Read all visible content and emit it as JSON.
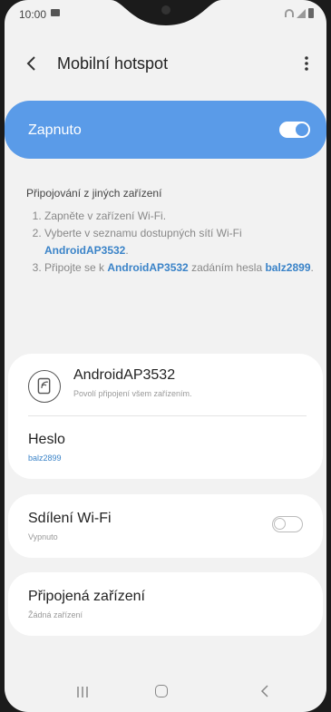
{
  "status": {
    "time": "10:00"
  },
  "header": {
    "title": "Mobilní hotspot"
  },
  "master": {
    "label": "Zapnuto",
    "state": "on"
  },
  "instructions": {
    "title": "Připojování z jiných zařízení",
    "step1": "Zapněte v zařízení Wi-Fi.",
    "step2_pre": "Vyberte v seznamu dostupných sítí Wi-Fi ",
    "step2_ssid": "AndroidAP3532",
    "step2_post": ".",
    "step3_pre": "Připojte se k ",
    "step3_ssid": "AndroidAP3532",
    "step3_mid": " zadáním hesla ",
    "step3_pw": "balz2899",
    "step3_post": "."
  },
  "network": {
    "name": "AndroidAP3532",
    "subtitle": "Povolí připojení všem zařízením.",
    "password_label": "Heslo",
    "password_value": "balz2899"
  },
  "wifi_sharing": {
    "title": "Sdílení Wi-Fi",
    "status": "Vypnuto"
  },
  "connected": {
    "title": "Připojená zařízení",
    "status": "Žádná zařízení"
  },
  "colors": {
    "accent": "#5a9be8",
    "link": "#3a83c8",
    "background": "#f2f2f2"
  }
}
